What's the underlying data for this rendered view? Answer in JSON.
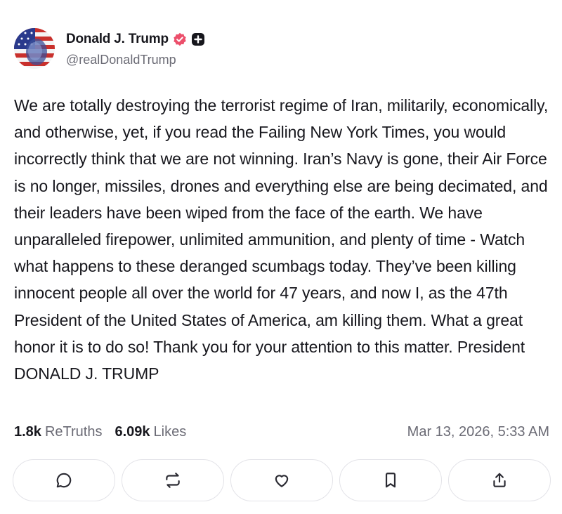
{
  "author": {
    "display_name": "Donald J. Trump",
    "handle": "@realDonaldTrump",
    "avatar_icon": "flag-portrait-avatar",
    "verified_icon": "verified-badge-icon",
    "verified_color": "#ec4f6b",
    "plus_badge_icon": "plus-badge-icon"
  },
  "post": {
    "text": "We are totally destroying the terrorist regime of Iran, militarily, economically, and otherwise, yet, if you read the Failing New York Times, you would incorrectly think that we are not winning. Iran’s Navy is gone, their Air Force is no longer, missiles, drones and everything else are being decimated, and their leaders have been wiped from the face of the earth. We have unparalleled firepower, unlimited ammunition, and plenty of time - Watch what happens to these deranged scumbags today. They’ve been killing innocent people all over the world for 47 years, and now I, as the 47th President of the United States of America, am killing them. What a great honor it is to do so! Thank you for your attention to this matter. President DONALD J. TRUMP"
  },
  "stats": {
    "retruths_count": "1.8k",
    "retruths_label": "ReTruths",
    "likes_count": "6.09k",
    "likes_label": "Likes",
    "timestamp": "Mar 13, 2026, 5:33 AM"
  },
  "actions": [
    {
      "name": "reply",
      "icon": "comment-icon"
    },
    {
      "name": "retruth",
      "icon": "repost-icon"
    },
    {
      "name": "like",
      "icon": "heart-icon"
    },
    {
      "name": "bookmark",
      "icon": "bookmark-icon"
    },
    {
      "name": "share",
      "icon": "share-icon"
    }
  ],
  "colors": {
    "text": "#17171d",
    "muted": "#6b6b75",
    "border": "#e3e3e8",
    "accent": "#ec4f6b"
  }
}
